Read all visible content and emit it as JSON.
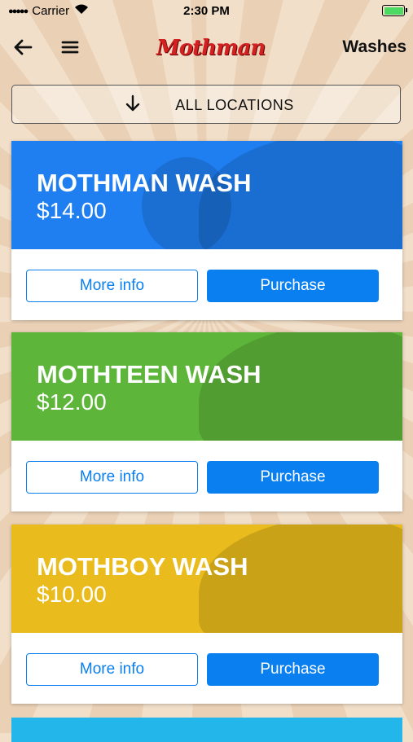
{
  "status_bar": {
    "carrier": "Carrier",
    "time": "2:30 PM"
  },
  "nav": {
    "logo_text": "Mothman",
    "title": "Washes",
    "back_icon": "back-arrow-icon",
    "menu_icon": "hamburger-menu-icon"
  },
  "location_filter": {
    "label": "ALL LOCATIONS",
    "icon": "down-arrow-icon"
  },
  "washes": [
    {
      "name": "MOTHMAN WASH",
      "price": "$14.00",
      "color": "#1f7ff0",
      "more_info_label": "More info",
      "purchase_label": "Purchase"
    },
    {
      "name": "MOTHTEEN WASH",
      "price": "$12.00",
      "color": "#5db53a",
      "more_info_label": "More info",
      "purchase_label": "Purchase"
    },
    {
      "name": "MOTHBOY WASH",
      "price": "$10.00",
      "color": "#e9bb1c",
      "more_info_label": "More info",
      "purchase_label": "Purchase"
    }
  ],
  "colors": {
    "accent": "#0a7ff0",
    "partial_card": "#22b6ea",
    "logo": "#d32020"
  }
}
